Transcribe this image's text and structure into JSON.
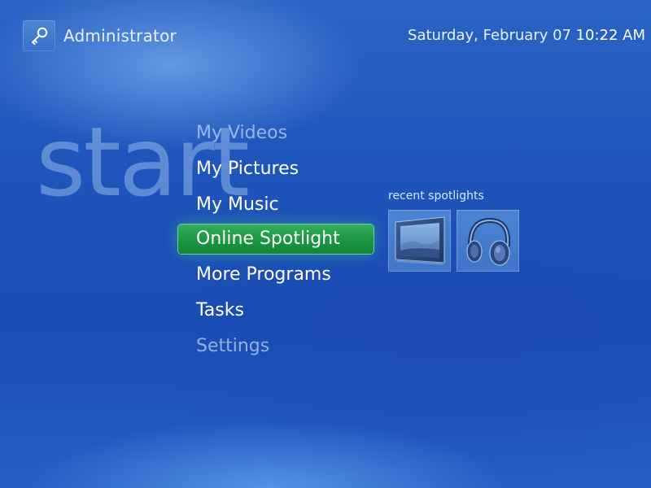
{
  "header": {
    "user_icon": "key-icon",
    "user_name": "Administrator",
    "date": "Saturday, February 07",
    "time": "10:22 AM"
  },
  "watermark": {
    "text": "start"
  },
  "menu": {
    "items": [
      {
        "label": "My Videos",
        "state": "dim"
      },
      {
        "label": "My Pictures",
        "state": "normal"
      },
      {
        "label": "My Music",
        "state": "normal"
      },
      {
        "label": "Online Spotlight",
        "state": "selected"
      },
      {
        "label": "More Programs",
        "state": "normal"
      },
      {
        "label": "Tasks",
        "state": "normal"
      },
      {
        "label": "Settings",
        "state": "dim"
      }
    ]
  },
  "recent_spotlights": {
    "title": "recent spotlights",
    "tiles": [
      {
        "icon": "framed-landscape-icon"
      },
      {
        "icon": "headphones-icon"
      }
    ]
  },
  "colors": {
    "background": "#1f55bb",
    "selection": "#1d9a43",
    "tile": "#4d84d4"
  }
}
